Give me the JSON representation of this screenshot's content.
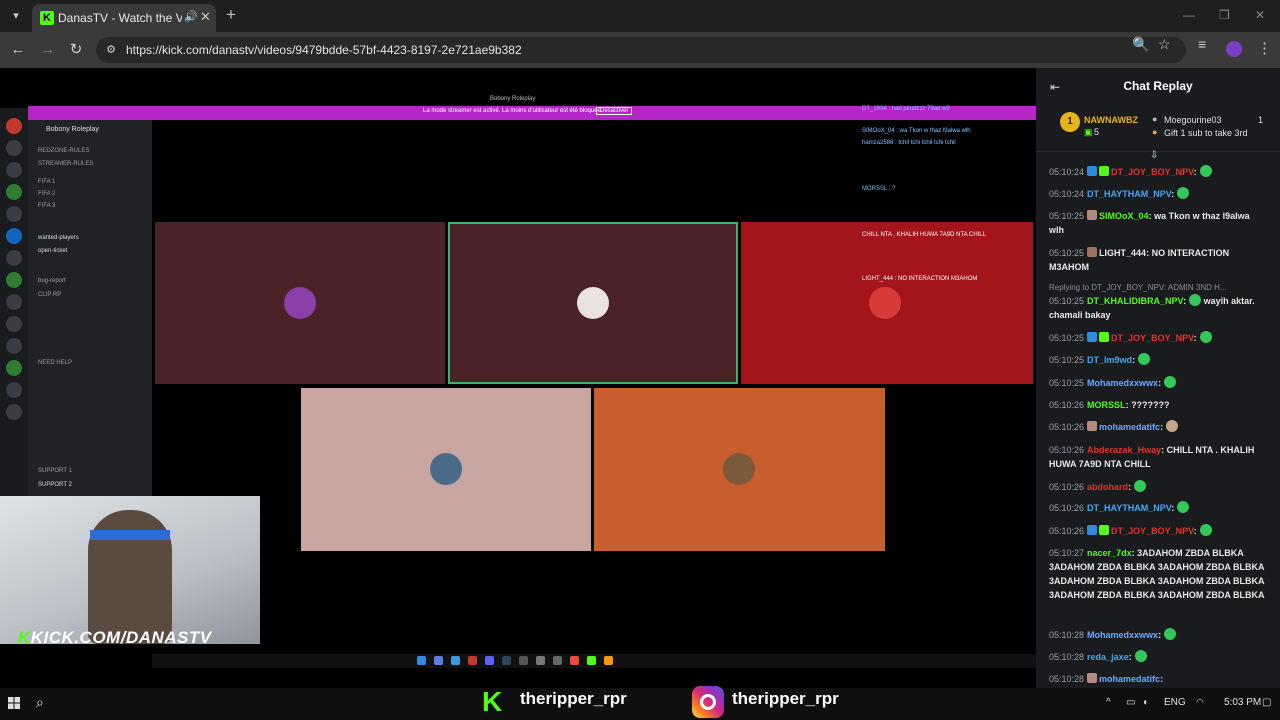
{
  "browser": {
    "tab_title": "DanasTV - Watch the VOD",
    "url": "https://kick.com/danastv/videos/9479bdde-57bf-4423-8197-2e721ae9b382"
  },
  "video": {
    "inner_window_title": "Bobony Roleplay",
    "inner_banner_text": "La mode streamer est activé. La moins d'utilisateur est été bloquée.",
    "inner_banner_button": "Désactiver",
    "discord": {
      "server_name": "Bobony Roleplay",
      "channels": [
        "REDZONE-RULES",
        "STREAMER-RULES",
        "FIFA 1",
        "FIFA 2",
        "FIFA 3",
        "wanted-players",
        "open-ticket",
        "bug-report",
        "CLIP RP",
        "NEED HELP",
        "SUPPORT 1",
        "SUPPORT 2"
      ]
    },
    "inner_chat_lines": [
      "DT_1994 : had pinatzzz 79ad w9",
      "SIMOoX_04 : wa Tkon w thaz l9alwa wlh",
      "hamza2586 : tchil tchi tchil tchi tchil",
      "MORSSL : ?",
      "CHILL NTA . KHALIH HUWA 7A9D NTA CHILL",
      "LIGHT_444 : NO INTERACTION M3AHOM"
    ],
    "watermark": "KICK.COM/DANASTV"
  },
  "chat": {
    "title": "Chat Replay",
    "pinned": {
      "gifter_name": "NAWNAWBZ",
      "gifter_rank": "1",
      "gifter_count": "5",
      "sub_user": "Moegourine03",
      "sub_count": "1",
      "sub_message": "Gift 1 sub to take 3rd"
    },
    "messages": [
      {
        "time": "05:10:24",
        "user": "DT_JOY_BOY_NPV",
        "color": "#e5322a",
        "text": ""
      },
      {
        "time": "05:10:24",
        "user": "DT_HAYTHAM_NPV",
        "color": "#3fa9f5",
        "text": ""
      },
      {
        "time": "05:10:25",
        "user": "SIMOoX_04",
        "color": "#53fc18",
        "text": "wa Tkon w thaz l9alwa wlh"
      },
      {
        "time": "05:10:25",
        "user": "LIGHT_444",
        "color": "#e8e8e8",
        "text": "NO INTERACTION M3AHOM"
      },
      {
        "time": "05:10:25",
        "user": "DT_KHALIDIBRA_NPV",
        "color": "#53fc18",
        "text": "wayih aktar. chamali bakay"
      },
      {
        "time": "05:10:25",
        "user": "DT_JOY_BOY_NPV",
        "color": "#e5322a",
        "text": ""
      },
      {
        "time": "05:10:25",
        "user": "DT_lm9wd",
        "color": "#3fa9f5",
        "text": ""
      },
      {
        "time": "05:10:25",
        "user": "Mohamedxxwwx",
        "color": "#6ea8ff",
        "text": ""
      },
      {
        "time": "05:10:26",
        "user": "MORSSL",
        "color": "#53fc18",
        "text": "???????"
      },
      {
        "time": "05:10:26",
        "user": "mohamedatifc",
        "color": "#6ea8ff",
        "text": ""
      },
      {
        "time": "05:10:26",
        "user": "Abderazak_Hway",
        "color": "#e5322a",
        "text": "CHILL NTA . KHALIH HUWA 7A9D NTA CHILL"
      },
      {
        "time": "05:10:26",
        "user": "abdohard",
        "color": "#e5322a",
        "text": ""
      },
      {
        "time": "05:10:26",
        "user": "DT_HAYTHAM_NPV",
        "color": "#3fa9f5",
        "text": ""
      },
      {
        "time": "05:10:26",
        "user": "DT_JOY_BOY_NPV",
        "color": "#e5322a",
        "text": ""
      },
      {
        "time": "05:10:27",
        "user": "nacer_7dx",
        "color": "#53fc18",
        "text": "3ADAHOM ZBDA BLBKA 3ADAHOM ZBDA BLBKA 3ADAHOM ZBDA BLBKA 3ADAHOM ZBDA BLBKA 3ADAHOM ZBDA BLBKA 3ADAHOM ZBDA BLBKA 3ADAHOM ZBDA BLBKA"
      },
      {
        "time": "05:10:28",
        "user": "Mohamedxxwwx",
        "color": "#6ea8ff",
        "text": ""
      },
      {
        "time": "05:10:28",
        "user": "reda_jaxe",
        "color": "#3fa9f5",
        "text": ""
      },
      {
        "time": "05:10:28",
        "user": "mohamedatifc",
        "color": "#6ea8ff",
        "text": ""
      }
    ],
    "reply_note": "Replying to DT_JOY_BOY_NPV: ADMIN 3ND H..."
  },
  "socials": {
    "kick_handle": "theripper_rpr",
    "instagram_handle": "theripper_rpr"
  },
  "taskbar": {
    "lang": "ENG",
    "time": "5:03 PM"
  }
}
